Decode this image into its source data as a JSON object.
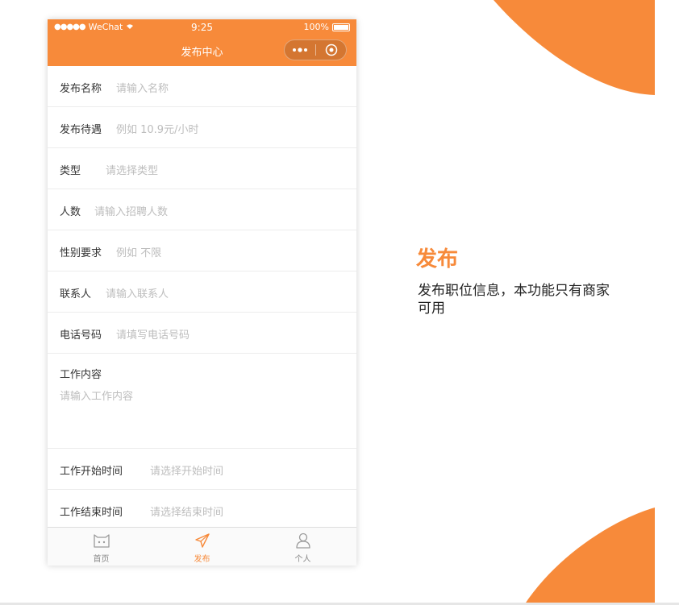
{
  "colors": {
    "accent": "#F78A3A",
    "text": "#333333",
    "placeholder": "#bdbdbd"
  },
  "status_bar": {
    "carrier": "WeChat",
    "time": "9:25",
    "battery": "100%"
  },
  "nav_bar": {
    "title": "发布中心"
  },
  "form": {
    "rows": [
      {
        "label": "发布名称",
        "placeholder": "请输入名称"
      },
      {
        "label": "发布待遇",
        "placeholder": "例如 10.9元/小时"
      },
      {
        "label": "类型",
        "placeholder": "请选择类型"
      },
      {
        "label": "人数",
        "placeholder": "请输入招聘人数"
      },
      {
        "label": "性别要求",
        "placeholder": "例如 不限"
      },
      {
        "label": "联系人",
        "placeholder": "请输入联系人"
      },
      {
        "label": "电话号码",
        "placeholder": "请填写电话号码"
      }
    ],
    "work_content": {
      "label": "工作内容",
      "placeholder": "请输入工作内容"
    },
    "time_rows": [
      {
        "label": "工作开始时间",
        "placeholder": "请选择开始时间"
      },
      {
        "label": "工作结束时间",
        "placeholder": "请选择结束时间"
      }
    ]
  },
  "tab_bar": {
    "tabs": [
      {
        "label": "首页",
        "icon": "cat-home-icon"
      },
      {
        "label": "发布",
        "icon": "paper-plane-icon"
      },
      {
        "label": "个人",
        "icon": "user-icon"
      }
    ],
    "active": "发布"
  },
  "info": {
    "title": "发布",
    "description": "发布职位信息，本功能只有商家可用"
  }
}
